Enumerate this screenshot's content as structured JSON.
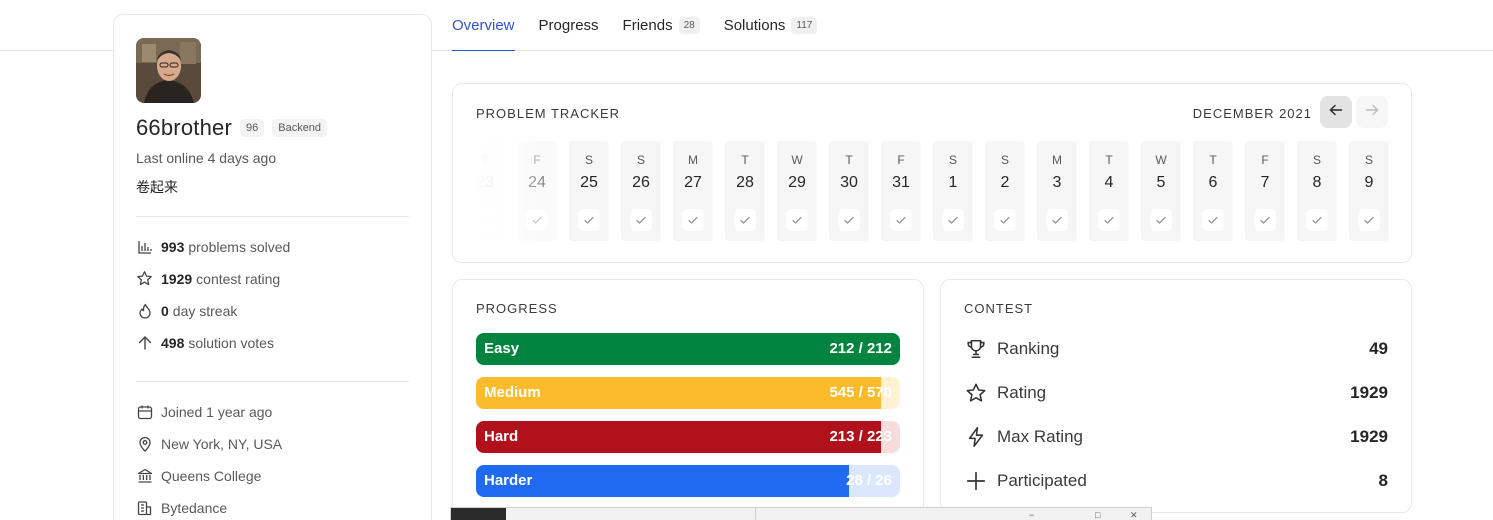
{
  "tabs": [
    {
      "label": "Overview",
      "count": ""
    },
    {
      "label": "Progress",
      "count": ""
    },
    {
      "label": "Friends",
      "count": "28"
    },
    {
      "label": "Solutions",
      "count": "117"
    }
  ],
  "profile": {
    "username": "66brother",
    "level": "96",
    "role_tag": "Backend",
    "last_online": "Last online 4 days ago",
    "motto": "卷起来",
    "stats": [
      {
        "icon": "bar-chart-icon",
        "value": "993",
        "label": "problems solved"
      },
      {
        "icon": "star-icon",
        "value": "1929",
        "label": "contest rating"
      },
      {
        "icon": "flame-icon",
        "value": "0",
        "label": "day streak"
      },
      {
        "icon": "arrow-up-icon",
        "value": "498",
        "label": "solution votes"
      }
    ],
    "info": [
      {
        "icon": "calendar-icon",
        "text": "Joined 1 year ago"
      },
      {
        "icon": "location-pin-icon",
        "text": "New York, NY, USA"
      },
      {
        "icon": "institution-icon",
        "text": "Queens College"
      },
      {
        "icon": "company-icon",
        "text": "Bytedance"
      }
    ]
  },
  "tracker": {
    "title": "PROBLEM TRACKER",
    "month": "DECEMBER 2021",
    "prev_icon": "arrow-left-icon",
    "next_icon": "arrow-right-icon",
    "days": [
      {
        "dow": "T",
        "num": "23"
      },
      {
        "dow": "F",
        "num": "24"
      },
      {
        "dow": "S",
        "num": "25"
      },
      {
        "dow": "S",
        "num": "26"
      },
      {
        "dow": "M",
        "num": "27"
      },
      {
        "dow": "T",
        "num": "28"
      },
      {
        "dow": "W",
        "num": "29"
      },
      {
        "dow": "T",
        "num": "30"
      },
      {
        "dow": "F",
        "num": "31"
      },
      {
        "dow": "S",
        "num": "1"
      },
      {
        "dow": "S",
        "num": "2"
      },
      {
        "dow": "M",
        "num": "3"
      },
      {
        "dow": "T",
        "num": "4"
      },
      {
        "dow": "W",
        "num": "5"
      },
      {
        "dow": "T",
        "num": "6"
      },
      {
        "dow": "F",
        "num": "7"
      },
      {
        "dow": "S",
        "num": "8"
      },
      {
        "dow": "S",
        "num": "9"
      }
    ]
  },
  "progress": {
    "title": "PROGRESS",
    "items": [
      {
        "label": "Easy",
        "solved": 212,
        "total": 212,
        "text": "212 / 212",
        "color": "#00843f",
        "track": "#d9efe2"
      },
      {
        "label": "Medium",
        "solved": 545,
        "total": 570,
        "text": "545 / 570",
        "color": "#fbbb2a",
        "track": "#fff2d4"
      },
      {
        "label": "Hard",
        "solved": 213,
        "total": 223,
        "text": "213 / 223",
        "color": "#b0111b",
        "track": "#f7dcdc"
      },
      {
        "label": "Harder",
        "solved": 28,
        "total": 26,
        "fill_fraction": 0.88,
        "text": "28 / 26",
        "color": "#1f6af0",
        "track": "#dbe7fd"
      }
    ]
  },
  "contest": {
    "title": "CONTEST",
    "rows": [
      {
        "icon": "trophy-icon",
        "label": "Ranking",
        "value": "49"
      },
      {
        "icon": "star-icon",
        "label": "Rating",
        "value": "1929"
      },
      {
        "icon": "lightning-icon",
        "label": "Max Rating",
        "value": "1929"
      },
      {
        "icon": "plus-icon",
        "label": "Participated",
        "value": "8"
      }
    ]
  }
}
